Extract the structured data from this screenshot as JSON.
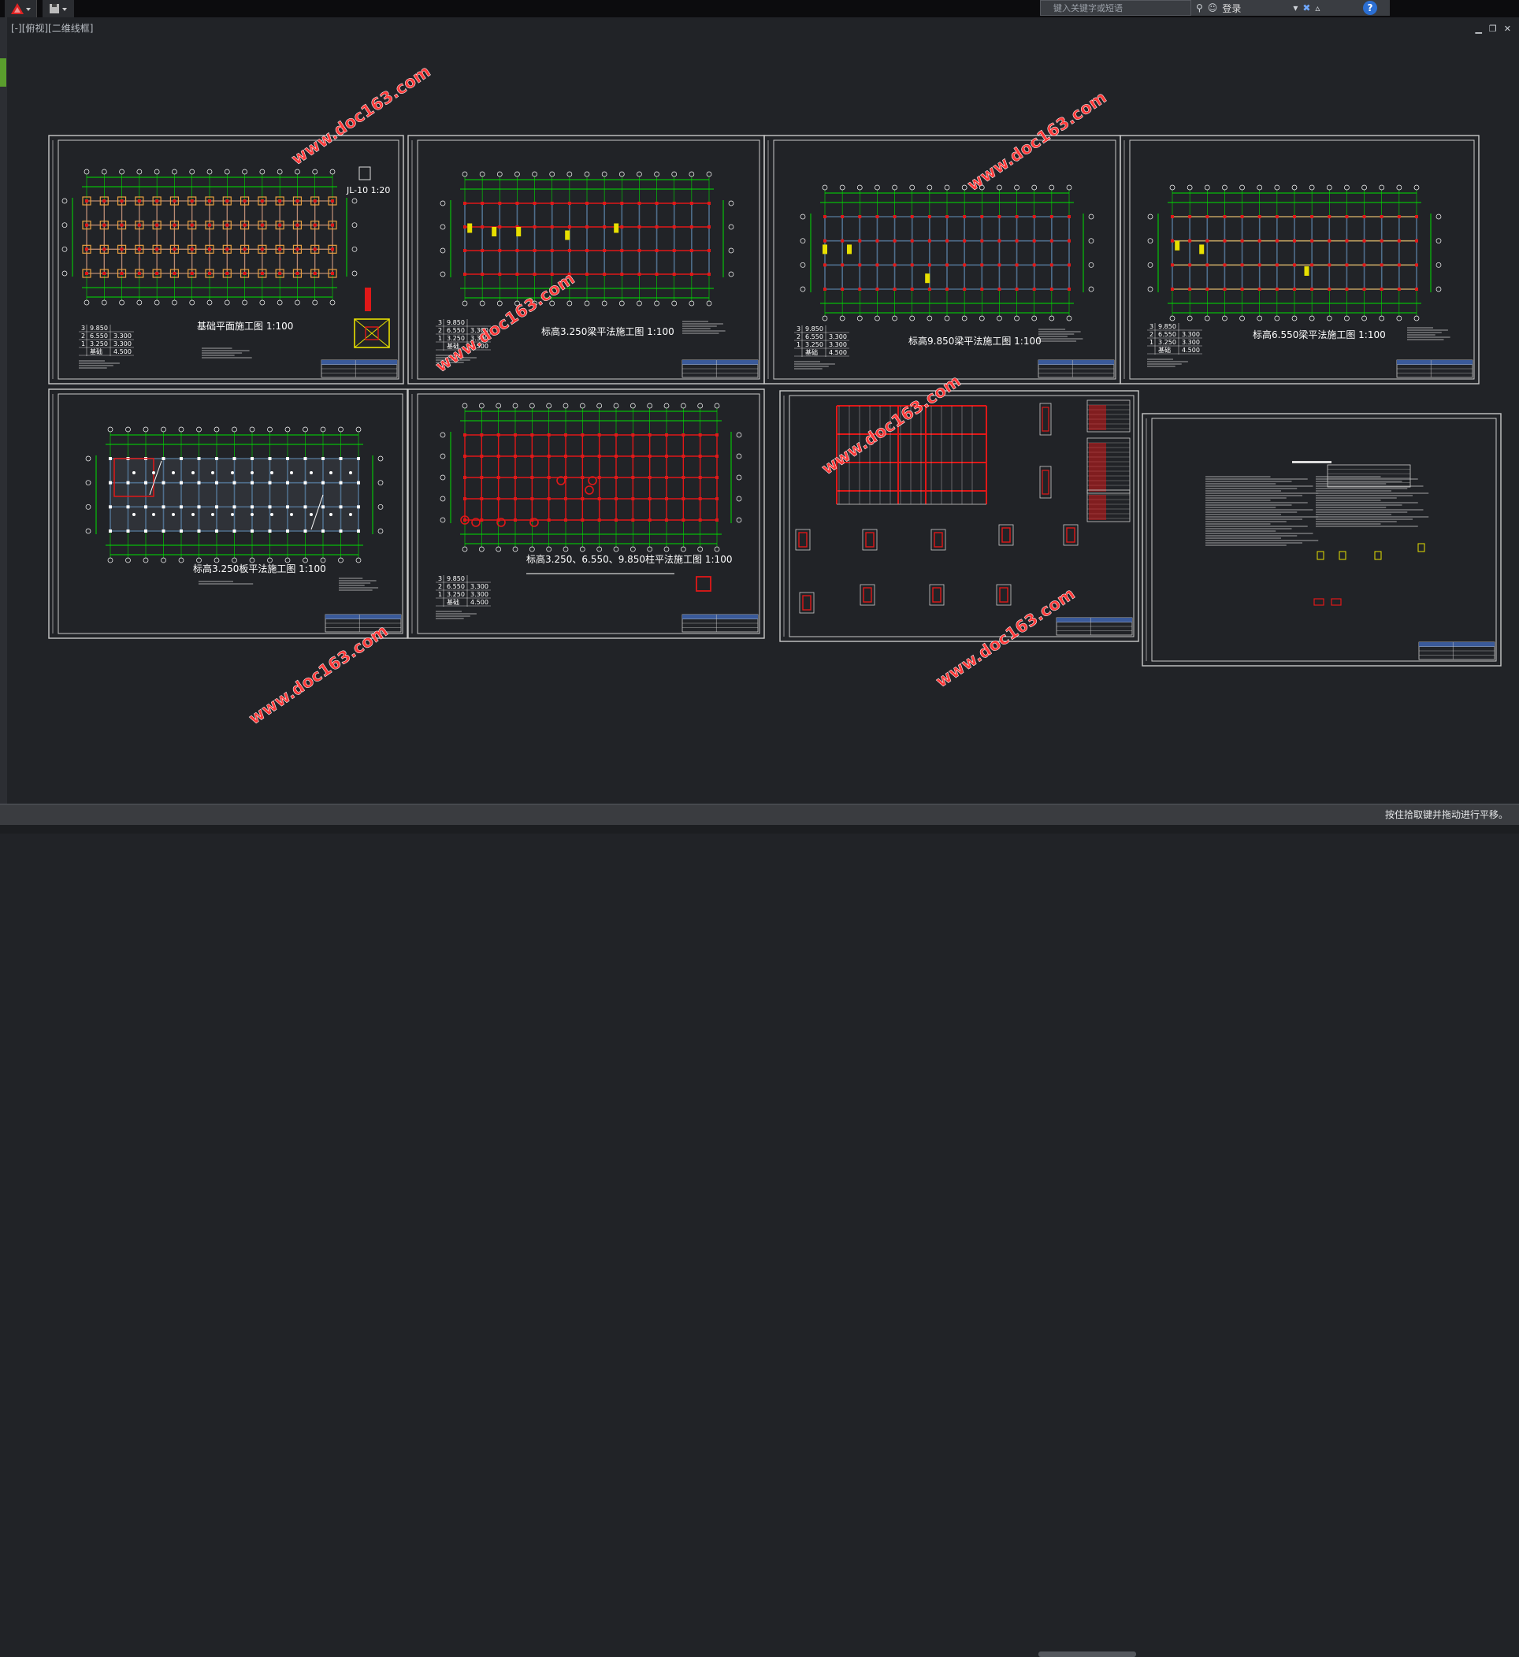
{
  "toolbar": {
    "search_placeholder": "键入关键字或短语",
    "login_label": "登录",
    "help_label": "?"
  },
  "viewport": {
    "label": "[-][俯视][二维线框]"
  },
  "drawings": [
    {
      "title": "基础平面施工图",
      "scale": "1:100",
      "detail_label": "JL-10",
      "detail_scale": "1:20"
    },
    {
      "title": "标高3.250梁平法施工图",
      "scale": "1:100"
    },
    {
      "title": "标高9.850梁平法施工图",
      "scale": "1:100"
    },
    {
      "title": "标高6.550梁平法施工图",
      "scale": "1:100"
    },
    {
      "title": "标高3.250板平法施工图",
      "scale": "1:100"
    },
    {
      "title": "标高3.250、6.550、9.850柱平法施工图",
      "scale": "1:100"
    }
  ],
  "floor_table": {
    "rows": [
      [
        "3",
        "9.850",
        ""
      ],
      [
        "2",
        "6.550",
        "3.300"
      ],
      [
        "1",
        "3.250",
        "3.300"
      ],
      [
        "",
        "基础",
        "4.500"
      ]
    ]
  },
  "watermark": "www.doc163.com",
  "colors": {
    "background": "#212327",
    "frame": "#c9c9c9",
    "axis": "#00e000",
    "column": "#e01818",
    "beam": "#6e7f96",
    "text": "#ffffff",
    "watermark": "#ff3a3a",
    "annotation": "#e8e000"
  },
  "status": {
    "text": "按住拾取键并拖动进行平移。"
  }
}
